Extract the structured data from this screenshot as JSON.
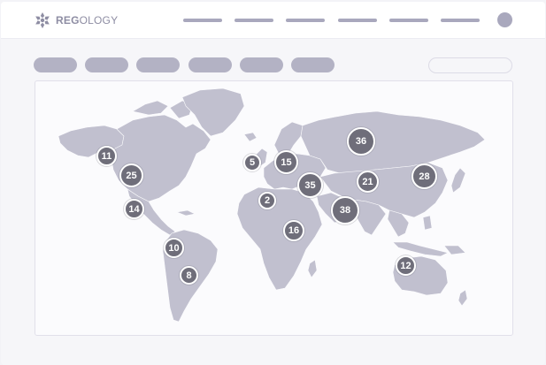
{
  "brand": {
    "logo_prefix": "REG",
    "logo_suffix": "OLOGY",
    "logo_icon": "snowflake-logo-icon"
  },
  "colors": {
    "land": "#c1c0cf",
    "marker": "#6f6e7a",
    "nav": "#a9a8bd",
    "pill": "#b3b2c4"
  },
  "nav": {
    "item_count": 6
  },
  "filters": {
    "pill_count": 6
  },
  "map": {
    "markers": [
      {
        "id": "marker-north-america-west",
        "label": "11",
        "size": "small"
      },
      {
        "id": "marker-north-america",
        "label": "25",
        "size": "medium"
      },
      {
        "id": "marker-central-america",
        "label": "14",
        "size": "small"
      },
      {
        "id": "marker-south-america-north",
        "label": "10",
        "size": "small"
      },
      {
        "id": "marker-south-america-south",
        "label": "8",
        "size": "small"
      },
      {
        "id": "marker-uk",
        "label": "5",
        "size": "small"
      },
      {
        "id": "marker-north-africa",
        "label": "2",
        "size": "small"
      },
      {
        "id": "marker-europe",
        "label": "15",
        "size": "medium"
      },
      {
        "id": "marker-middle-east",
        "label": "35",
        "size": "medium"
      },
      {
        "id": "marker-russia",
        "label": "36",
        "size": "large"
      },
      {
        "id": "marker-central-asia",
        "label": "21",
        "size": "medium"
      },
      {
        "id": "marker-india",
        "label": "38",
        "size": "large"
      },
      {
        "id": "marker-east-asia",
        "label": "28",
        "size": "medium"
      },
      {
        "id": "marker-africa",
        "label": "16",
        "size": "small"
      },
      {
        "id": "marker-australia",
        "label": "12",
        "size": "small"
      }
    ]
  }
}
